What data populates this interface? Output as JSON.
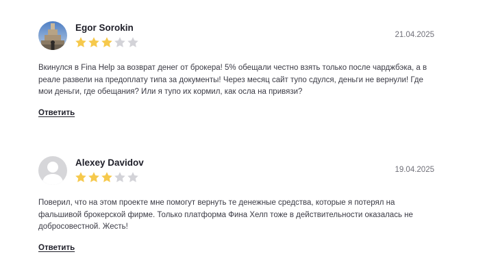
{
  "reviews": [
    {
      "author": "Egor Sorokin",
      "date": "21.04.2025",
      "rating": 3,
      "max_rating": 5,
      "avatar": "photo-avatar",
      "text": "Вкинулся в Fina Help за возврат денег от брокера! 5% обещали честно взять только после чарджбэка, а в реале развели на предоплату типа за документы! Через месяц сайт тупо сдулся, деньги не вернули! Где мои деньги, где обещания? Или я тупо их кормил, как осла на привязи?",
      "reply_label": "Ответить"
    },
    {
      "author": "Alexey Davidov",
      "date": "19.04.2025",
      "rating": 3,
      "max_rating": 5,
      "avatar": "default-user-avatar",
      "text": "Поверил, что на этом проекте мне помогут вернуть те денежные средства, которые я потерял на фальшивой брокерской фирме. Только платформа Фина Хелп тоже в действительности оказалась не добросовестной. Жесть!",
      "reply_label": "Ответить"
    }
  ],
  "colors": {
    "star_filled": "#f6c94c",
    "star_empty": "#d3d3d8",
    "text": "#3a3a44",
    "date": "#6f6f78"
  }
}
